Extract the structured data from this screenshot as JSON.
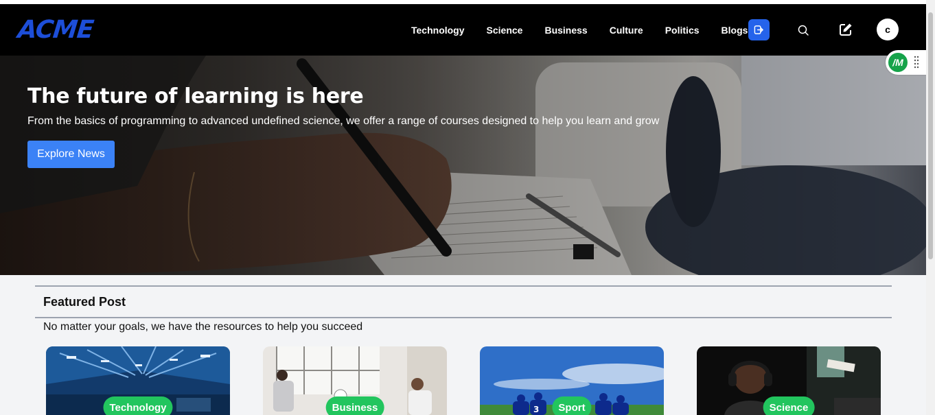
{
  "header": {
    "logo": "ACME",
    "nav": [
      "Technology",
      "Science",
      "Business",
      "Culture",
      "Politics",
      "Blogs"
    ],
    "avatar_initial": "c",
    "icons": {
      "logout": "logout-icon",
      "search": "search-icon",
      "edit": "edit-icon"
    }
  },
  "hero": {
    "title": "The future of learning is here",
    "subtitle": "From the basics of programming to advanced undefined science, we offer a range of courses designed to help you learn and grow",
    "cta_label": "Explore News"
  },
  "extension": {
    "label": "/M"
  },
  "featured": {
    "title": "Featured Post",
    "subtitle": "No matter your goals, we have the resources to help you succeed",
    "cards": [
      {
        "category": "Technology",
        "image": "warehouse-image"
      },
      {
        "category": "Business",
        "image": "meeting-image"
      },
      {
        "category": "Sport",
        "image": "soccer-team-image"
      },
      {
        "category": "Science",
        "image": "headphones-man-image"
      }
    ]
  },
  "colors": {
    "accent_blue": "#3b82f6",
    "logo_blue": "#1d4ed8",
    "badge_green": "#22c55e",
    "navbar_bg": "#000000"
  }
}
